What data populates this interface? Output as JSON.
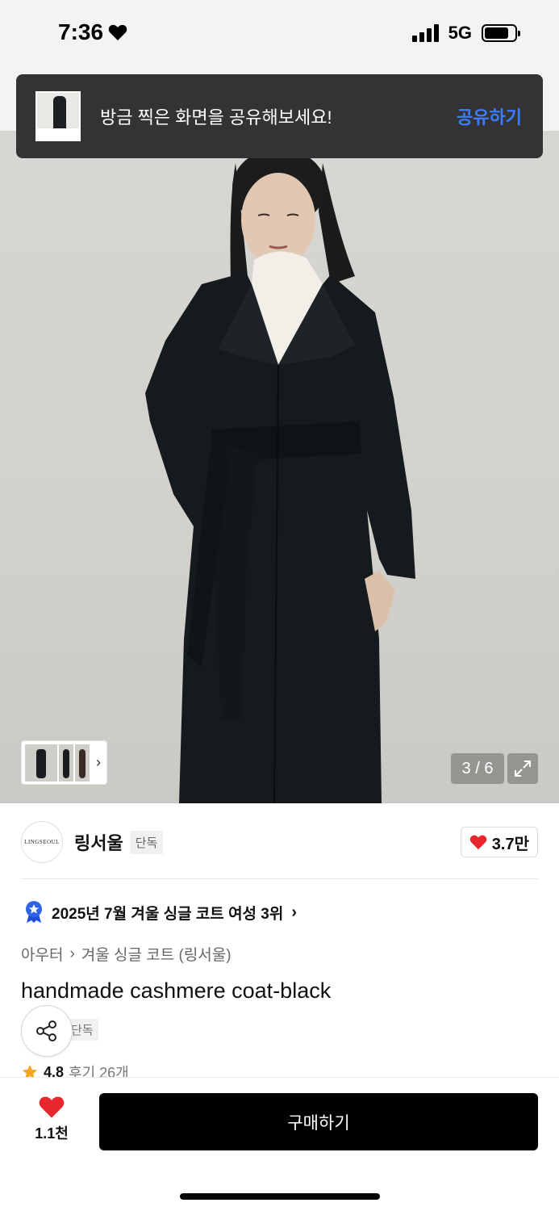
{
  "status_bar": {
    "time": "7:36",
    "network": "5G",
    "battery_level": 0.8
  },
  "toast": {
    "message": "방금 찍은 화면을 공유해보세요!",
    "action": "공유하기"
  },
  "gallery": {
    "counter": "3 / 6"
  },
  "brand": {
    "logo_text": "LINGSEOUL",
    "name": "링서울",
    "badge": "단독",
    "likes": "3.7만"
  },
  "ranking": {
    "text": "2025년 7월 겨울 싱글 코트 여성 3위"
  },
  "breadcrumb": {
    "category": "아우터",
    "subcategory": "겨울 싱글 코트 (링서울)"
  },
  "product": {
    "title": "handmade cashmere coat-black",
    "tag": "단독",
    "rating": "4.8",
    "reviews": "후기 26개"
  },
  "bottom": {
    "wish_count": "1.1천",
    "buy_label": "구매하기"
  },
  "colors": {
    "accent_blue": "#3d7bff",
    "heart_red": "#e8262d",
    "star_orange": "#f5a623",
    "badge_blue": "#2f62e6"
  }
}
